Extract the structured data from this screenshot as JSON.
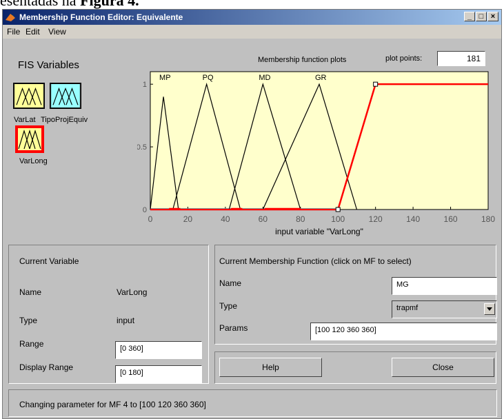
{
  "doc": {
    "fragment": "esentadas na ",
    "bold": "Figura 4."
  },
  "window": {
    "title": "Membership Function Editor: Equivalente",
    "menu": [
      "File",
      "Edit",
      "View"
    ],
    "controls": {
      "minimize": "_",
      "maximize": "□",
      "close": "×"
    }
  },
  "fis": {
    "title": "FIS Variables",
    "variables": [
      {
        "label": "VarLat",
        "color": "#ffff99",
        "selected": false
      },
      {
        "label": "TipoProjEquiv",
        "color": "#99ffff",
        "selected": false
      },
      {
        "label": "VarLong",
        "color": "#ffff99",
        "selected": true
      }
    ]
  },
  "plot": {
    "title": "Membership function plots",
    "points_label": "plot points:",
    "points_value": "181",
    "xlabel": "input variable \"VarLong\"",
    "background": "#ffffcc",
    "mf_labels": [
      "MP",
      "PQ",
      "MD",
      "GR"
    ],
    "y_ticks": [
      "0",
      "0.5",
      "1"
    ],
    "x_ticks": [
      "0",
      "20",
      "40",
      "60",
      "80",
      "100",
      "120",
      "140",
      "160",
      "180"
    ]
  },
  "chart_data": {
    "type": "line",
    "xlim": [
      0,
      180
    ],
    "ylim": [
      0,
      1.1
    ],
    "series": [
      {
        "name": "MP",
        "x": [
          0,
          7,
          15
        ],
        "y": [
          0,
          0.9,
          0
        ],
        "color": "#000000"
      },
      {
        "name": "PQ",
        "x": [
          12,
          30,
          48
        ],
        "y": [
          0,
          1,
          0
        ],
        "color": "#000000"
      },
      {
        "name": "MD",
        "x": [
          42,
          60,
          80
        ],
        "y": [
          0,
          1,
          0
        ],
        "color": "#000000"
      },
      {
        "name": "GR",
        "x": [
          60,
          90,
          110
        ],
        "y": [
          0,
          1,
          0
        ],
        "color": "#000000"
      },
      {
        "name": "MG",
        "x": [
          0,
          100,
          120,
          180
        ],
        "y": [
          0,
          0,
          1,
          1
        ],
        "color": "#ff0000"
      }
    ]
  },
  "current_variable": {
    "header": "Current Variable",
    "name_label": "Name",
    "name_value": "VarLong",
    "type_label": "Type",
    "type_value": "input",
    "range_label": "Range",
    "range_value": "[0 360]",
    "display_range_label": "Display Range",
    "display_range_value": "[0 180]"
  },
  "current_mf": {
    "header": "Current Membership Function (click on MF to select)",
    "name_label": "Name",
    "name_value": "MG",
    "type_label": "Type",
    "type_value": "trapmf",
    "params_label": "Params",
    "params_value": "[100 120 360 360]"
  },
  "buttons": {
    "help": "Help",
    "close": "Close"
  },
  "status": "Changing parameter for MF 4 to  [100 120 360 360]"
}
